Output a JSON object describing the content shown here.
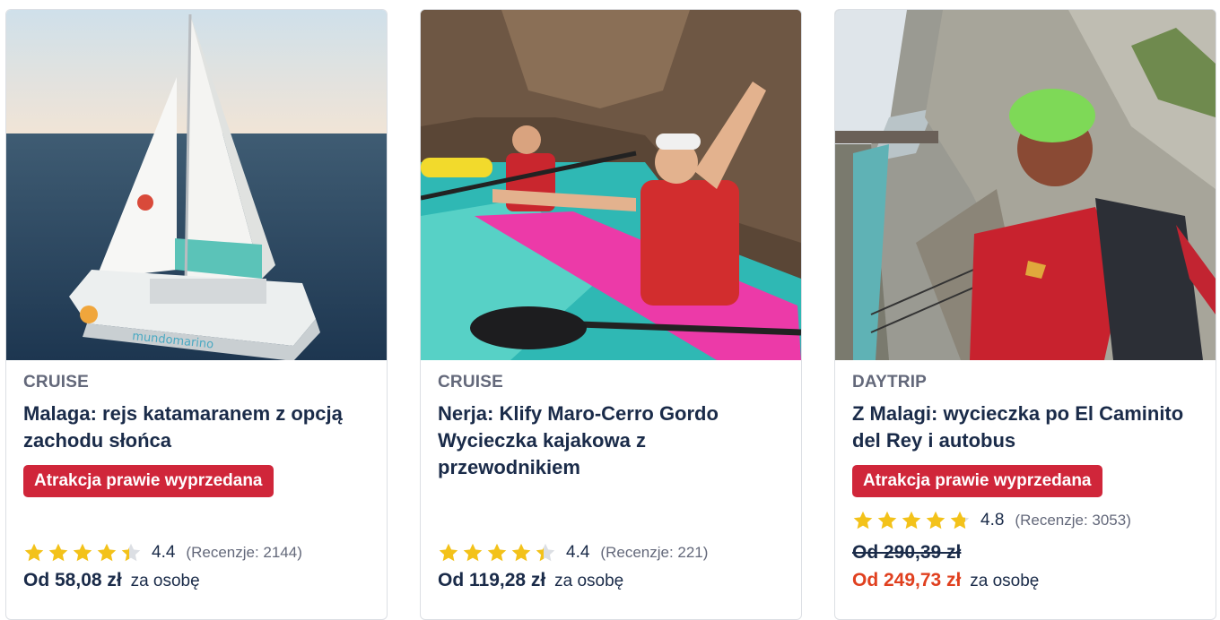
{
  "cards": [
    {
      "category": "CRUISE",
      "title": "Malaga: rejs katamaranem z opcją zachodu słońca",
      "badge": "Atrakcja prawie wyprzedana",
      "rating": 4.4,
      "rating_text": "4.4",
      "reviews": "(Recenzje: 2144)",
      "price_prefix": "Od 58,08 zł",
      "price_unit": "za osobę"
    },
    {
      "category": "CRUISE",
      "title": "Nerja: Klify Maro-Cerro Gordo Wycieczka kajakowa z przewodnikiem",
      "rating": 4.4,
      "rating_text": "4.4",
      "reviews": "(Recenzje: 221)",
      "price_prefix": "Od 119,28 zł",
      "price_unit": "za osobę"
    },
    {
      "category": "DAYTRIP",
      "title": "Z Malagi: wycieczka po El Caminito del Rey i autobus",
      "badge": "Atrakcja prawie wyprzedana",
      "rating": 4.8,
      "rating_text": "4.8",
      "reviews": "(Recenzje: 3053)",
      "old_price": "Od 290,39 zł",
      "price_prefix": "Od 249,73 zł",
      "price_unit": "za osobę"
    }
  ],
  "images": [
    "catamaran-photo",
    "kayak-photo",
    "caminito-photo"
  ],
  "colors": {
    "text": "#1a2b49",
    "muted": "#63687a",
    "badge": "#d0263a",
    "sale": "#e0401f",
    "star": "#f3c21a"
  }
}
